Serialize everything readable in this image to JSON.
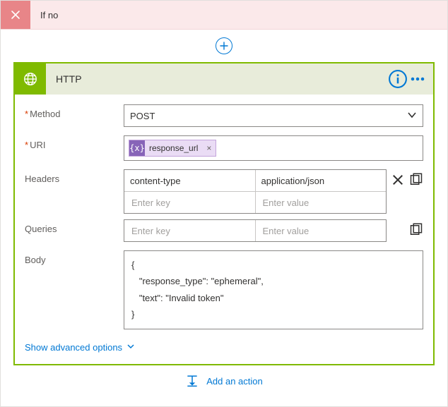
{
  "condition": {
    "branch_label": "If no"
  },
  "http_card": {
    "title": "HTTP",
    "labels": {
      "method": "Method",
      "uri": "URI",
      "headers": "Headers",
      "queries": "Queries",
      "body": "Body",
      "show_advanced": "Show advanced options"
    },
    "method": {
      "value": "POST"
    },
    "uri": {
      "tokens": [
        {
          "kind": "expression",
          "text": "response_url"
        }
      ]
    },
    "headers": {
      "rows": [
        {
          "key": "content-type",
          "value": "application/json"
        }
      ],
      "placeholders": {
        "key": "Enter key",
        "value": "Enter value"
      }
    },
    "queries": {
      "rows": [],
      "placeholders": {
        "key": "Enter key",
        "value": "Enter value"
      }
    },
    "body": "{\n   \"response_type\": \"ephemeral\",\n   \"text\": \"Invalid token\"\n}"
  },
  "footer": {
    "add_action_label": "Add an action"
  }
}
